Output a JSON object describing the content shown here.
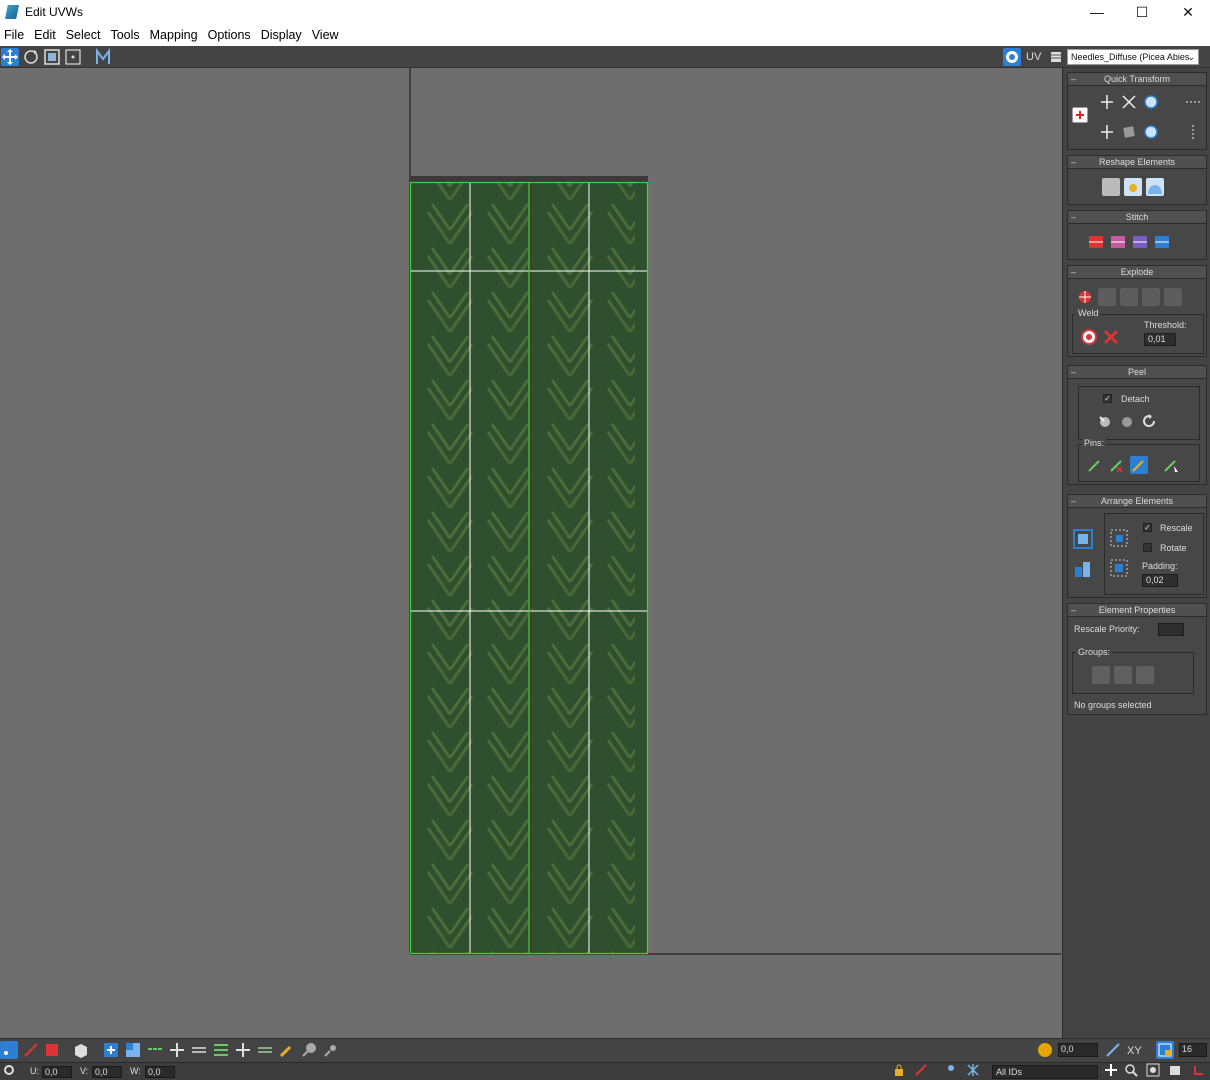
{
  "window": {
    "title": "Edit UVWs"
  },
  "window_controls": {
    "minimize": "—",
    "maximize": "☐",
    "close": "✕"
  },
  "menu": [
    "File",
    "Edit",
    "Select",
    "Tools",
    "Mapping",
    "Options",
    "Display",
    "View"
  ],
  "toolbar": {
    "uv_label": "UV",
    "texture_dropdown": "Needles_Diffuse (Picea Abies"
  },
  "panels": {
    "quick_transform": {
      "title": "Quick Transform"
    },
    "reshape_elements": {
      "title": "Reshape Elements"
    },
    "stitch": {
      "title": "Stitch"
    },
    "explode": {
      "title": "Explode",
      "weld_label": "Weld",
      "threshold_label": "Threshold:",
      "threshold_value": "0,01"
    },
    "peel": {
      "title": "Peel",
      "detach_label": "Detach",
      "detach_checked": true,
      "pins_label": "Pins:"
    },
    "arrange_elements": {
      "title": "Arrange Elements",
      "rescale_label": "Rescale",
      "rescale_checked": true,
      "rotate_label": "Rotate",
      "rotate_checked": false,
      "padding_label": "Padding:",
      "padding_value": "0,02"
    },
    "element_properties": {
      "title": "Element Properties",
      "rescale_priority_label": "Rescale Priority:",
      "groups_label": "Groups:",
      "no_groups_text": "No groups selected"
    }
  },
  "bottom": {
    "value_field": "0,0",
    "xy_label": "XY",
    "grid_value": "16"
  },
  "status": {
    "u_label": "U:",
    "u_value": "0,0",
    "v_label": "V:",
    "v_value": "0,0",
    "w_label": "W:",
    "w_value": "0,0",
    "ids_dropdown": "All IDs"
  },
  "colors": {
    "viewport_bg": "#6e6e6e",
    "panel_bg": "#444444",
    "uv_edge": "#3ad63a",
    "grid_line": "#ffffff",
    "texture_base": "#2f4f2e",
    "accent_blue": "#2d7fd4"
  }
}
